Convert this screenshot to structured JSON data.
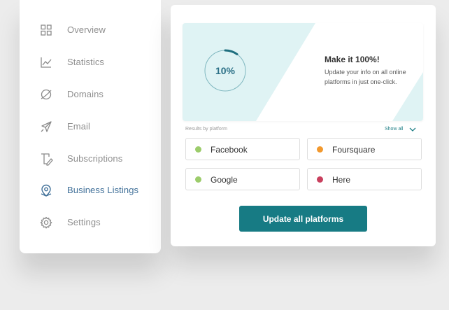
{
  "sidebar": {
    "items": [
      {
        "label": "Overview",
        "icon": "grid-icon",
        "active": false
      },
      {
        "label": "Statistics",
        "icon": "chart-icon",
        "active": false
      },
      {
        "label": "Domains",
        "icon": "globe-icon",
        "active": false
      },
      {
        "label": "Email",
        "icon": "send-icon",
        "active": false
      },
      {
        "label": "Subscriptions",
        "icon": "document-pen-icon",
        "active": false
      },
      {
        "label": "Business Listings",
        "icon": "map-pin-icon",
        "active": true
      },
      {
        "label": "Settings",
        "icon": "gear-icon",
        "active": false
      }
    ]
  },
  "hero": {
    "progress_text": "10%",
    "progress_fraction": 0.1,
    "title": "Make it 100%!",
    "description": "Update your info on all online platforms in just one-click."
  },
  "results": {
    "label": "Results by platform",
    "show_all": "Show all"
  },
  "platforms": [
    {
      "name": "Facebook",
      "status_color": "#9ccc6b"
    },
    {
      "name": "Foursquare",
      "status_color": "#f2992e"
    },
    {
      "name": "Google",
      "status_color": "#9ccc6b"
    },
    {
      "name": "Here",
      "status_color": "#c9405e"
    }
  ],
  "cta": {
    "label": "Update all platforms"
  },
  "colors": {
    "accent": "#177b84",
    "active_nav": "#3f6f98",
    "hero_tint": "#dff3f4"
  }
}
